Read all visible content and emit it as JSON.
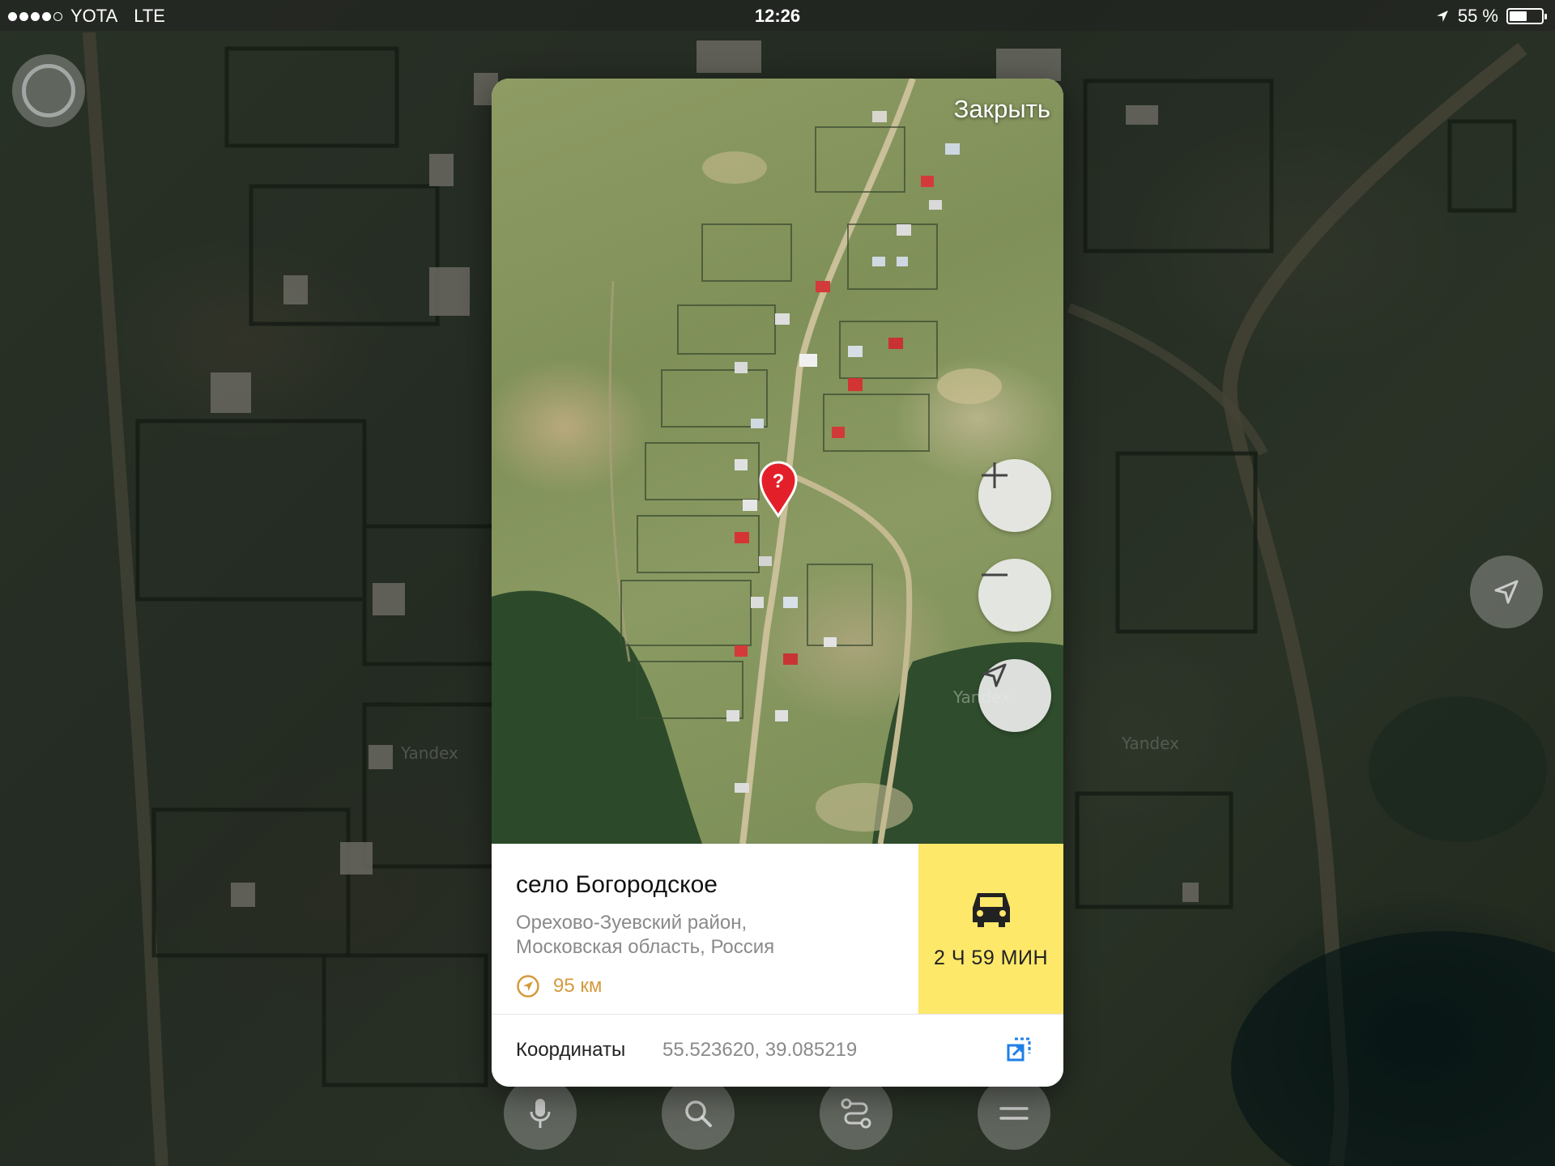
{
  "status_bar": {
    "carrier": "YOTA",
    "network": "LTE",
    "time": "12:26",
    "battery": "55 %",
    "battery_level": 0.55,
    "signal_bars": 4,
    "signal_max": 5
  },
  "map": {
    "watermark": "Yandex",
    "card_watermark": "Yandex"
  },
  "card": {
    "close_label": "Закрыть",
    "title": "село Богородское",
    "address": "Орехово-Зуевский район, Московская область, Россия",
    "distance": "95 км",
    "route_time": "2 Ч 59 МИН",
    "coords_label": "Координаты",
    "coords_value": "55.523620, 39.085219"
  },
  "icons": {
    "alice": "alice-voice-assistant-icon",
    "zoom_in": "plus-icon",
    "zoom_out": "minus-icon",
    "locate": "location-arrow-icon",
    "pin": "question-marker-icon",
    "car": "car-icon",
    "distance": "compass-arrow-icon",
    "copy": "copy-coordinates-icon",
    "mic": "microphone-icon",
    "search": "search-icon",
    "routes": "routes-icon",
    "menu": "menu-icon"
  },
  "colors": {
    "route_box": "#fde86a",
    "distance_text": "#d59a3d",
    "pin": "#e3202a",
    "copy_icon": "#1e7fe8"
  }
}
